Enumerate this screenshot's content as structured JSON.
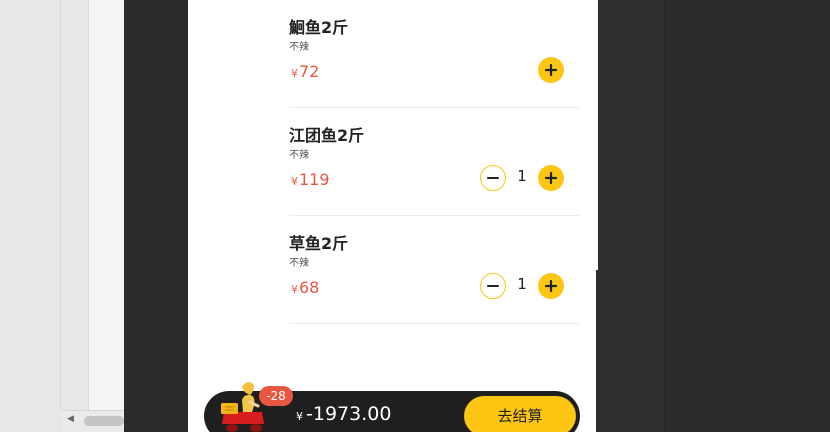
{
  "items": [
    {
      "name": "鮰鱼2斤",
      "spec": "不辣",
      "currency": "¥",
      "price": "72",
      "qty": ""
    },
    {
      "name": "江团鱼2斤",
      "spec": "不辣",
      "currency": "¥",
      "price": "119",
      "qty": "1"
    },
    {
      "name": "草鱼2斤",
      "spec": "不辣",
      "currency": "¥",
      "price": "68",
      "qty": "1"
    }
  ],
  "cart": {
    "badge": "-28",
    "currency": "¥",
    "total": "-1973.00",
    "checkout_label": "去结算"
  },
  "colors": {
    "accent": "#fcc612",
    "price": "#e8573f",
    "bar": "#1f1f1f"
  },
  "icons": {
    "add": "plus-icon",
    "remove": "minus-icon",
    "cart": "delivery-rider-icon",
    "scroll_left": "left-arrow-icon"
  }
}
